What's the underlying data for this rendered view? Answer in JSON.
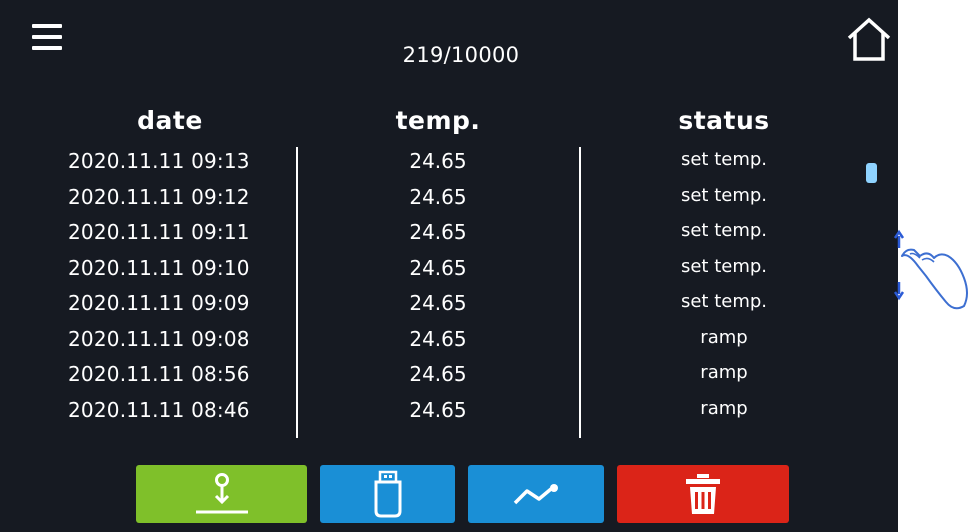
{
  "header": {
    "counter": "219/10000",
    "menu_icon": "hamburger-menu-icon",
    "home_icon": "home-icon"
  },
  "table": {
    "columns": {
      "date": "date",
      "temp": "temp.",
      "status": "status"
    },
    "rows": [
      {
        "date": "2020.11.11  09:13",
        "temp": "24.65",
        "status": "set temp."
      },
      {
        "date": "2020.11.11  09:12",
        "temp": "24.65",
        "status": "set temp."
      },
      {
        "date": "2020.11.11  09:11",
        "temp": "24.65",
        "status": "set temp."
      },
      {
        "date": "2020.11.11  09:10",
        "temp": "24.65",
        "status": "set temp."
      },
      {
        "date": "2020.11.11  09:09",
        "temp": "24.65",
        "status": "set temp."
      },
      {
        "date": "2020.11.11  09:08",
        "temp": "24.65",
        "status": "ramp"
      },
      {
        "date": "2020.11.11  08:56",
        "temp": "24.65",
        "status": "ramp"
      },
      {
        "date": "2020.11.11  08:46",
        "temp": "24.65",
        "status": "ramp"
      }
    ]
  },
  "toolbar": {
    "buttons": [
      {
        "icon": "download-icon",
        "color": "#7fc02a"
      },
      {
        "icon": "usb-drive-icon",
        "color": "#1a8fd6"
      },
      {
        "icon": "chart-line-icon",
        "color": "#1a8fd6"
      },
      {
        "icon": "trash-icon",
        "color": "#db2418"
      }
    ]
  },
  "colors": {
    "background": "#161a22",
    "text": "#ffffff",
    "accent_blue": "#1a8fd6",
    "scroll_thumb": "#8fd3ff",
    "gesture_outline": "#3d6fd1"
  },
  "gesture_hint": {
    "icon": "swipe-hand-icon"
  }
}
